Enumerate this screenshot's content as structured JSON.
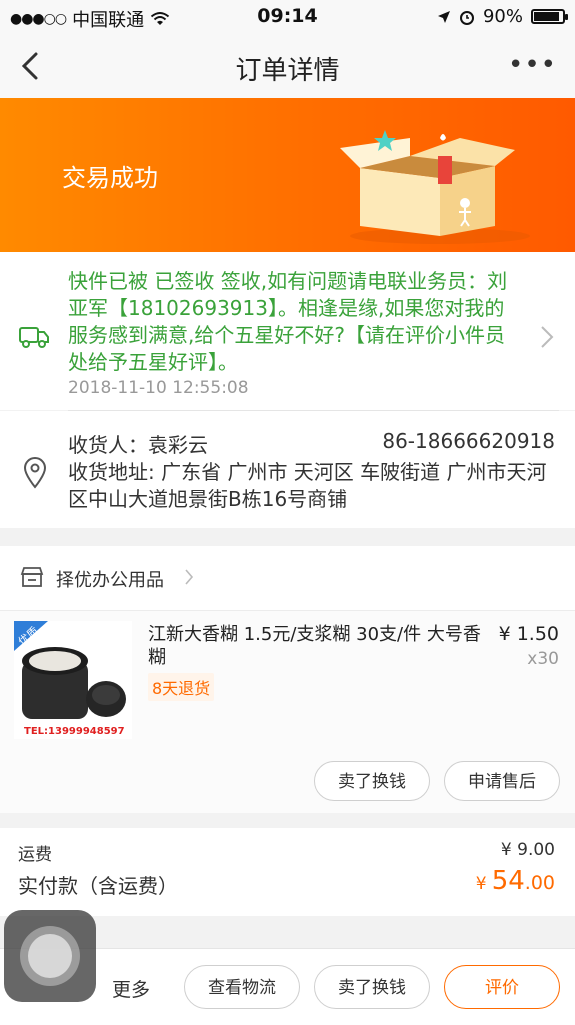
{
  "status_bar": {
    "carrier": "中国联通",
    "time": "09:14",
    "battery": "90%",
    "battery_level": 0.9
  },
  "nav": {
    "title": "订单详情",
    "more": "•••"
  },
  "banner": {
    "status": "交易成功"
  },
  "logistics": {
    "message": "快件已被 已签收 签收,如有问题请电联业务员：刘亚军【18102693913】。相逢是缘,如果您对我的服务感到满意,给个五星好不好?【请在评价小件员处给予五星好评】。",
    "time": "2018-11-10 12:55:08"
  },
  "address": {
    "receiver": "收货人：袁彩云",
    "phone": "86-18666620918",
    "detail": "收货地址: 广东省 广州市 天河区 车陂街道 广州市天河区中山大道旭景街B栋16号商铺"
  },
  "shop": {
    "name": "择优办公用品"
  },
  "product": {
    "title": "江新大香糊 1.5元/支浆糊 30支/件 大号香糊",
    "price": "¥ 1.50",
    "qty": "x30",
    "tag": "8天退货",
    "thumb_badge": "优质",
    "thumb_tel": "TEL:13999948597",
    "btn_sell": "卖了换钱",
    "btn_after_sale": "申请售后"
  },
  "totals": {
    "shipping_label": "运费",
    "shipping_value": "¥ 9.00",
    "paid_label": "实付款（含运费）",
    "paid_yen": "¥",
    "paid_int": "54",
    "paid_dec": ".00"
  },
  "bottom": {
    "more": "更多",
    "btn_logistics": "查看物流",
    "btn_sell": "卖了换钱",
    "btn_review": "评价"
  },
  "colors": {
    "accent": "#ff6a00",
    "success_green": "#3aa23a"
  }
}
